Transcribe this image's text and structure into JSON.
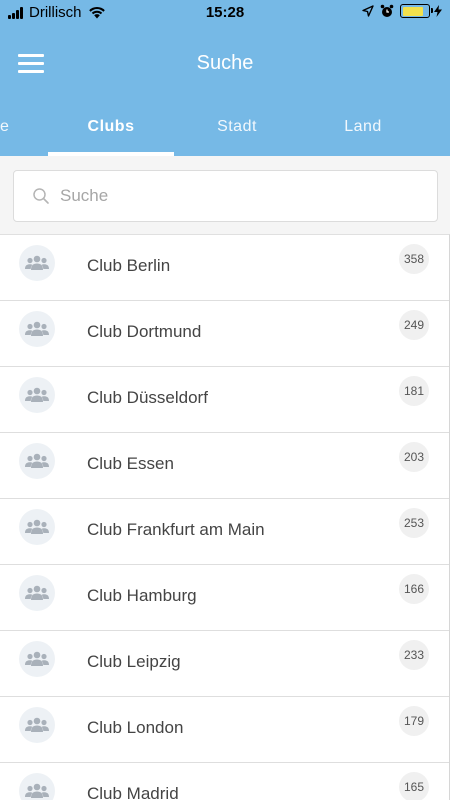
{
  "status_bar": {
    "carrier": "Drillisch",
    "time": "15:28"
  },
  "header": {
    "title": "Suche"
  },
  "tabs": [
    {
      "label": "e"
    },
    {
      "label": "Clubs"
    },
    {
      "label": "Stadt"
    },
    {
      "label": "Land"
    }
  ],
  "search": {
    "placeholder": "Suche",
    "value": ""
  },
  "clubs": [
    {
      "name": "Club Berlin",
      "count": "358"
    },
    {
      "name": "Club Dortmund",
      "count": "249"
    },
    {
      "name": "Club Düsseldorf",
      "count": "181"
    },
    {
      "name": "Club Essen",
      "count": "203"
    },
    {
      "name": "Club Frankfurt am Main",
      "count": "253"
    },
    {
      "name": "Club Hamburg",
      "count": "166"
    },
    {
      "name": "Club Leipzig",
      "count": "233"
    },
    {
      "name": "Club London",
      "count": "179"
    },
    {
      "name": "Club Madrid",
      "count": "165"
    }
  ],
  "colors": {
    "header_bg": "#76b9e6",
    "battery_fill": "#f2e14c",
    "avatar_bg": "#edf1f5",
    "badge_bg": "#f0f0f0"
  },
  "icons": {
    "menu": "hamburger-icon",
    "search": "search-icon",
    "club_avatar": "group-icon"
  }
}
